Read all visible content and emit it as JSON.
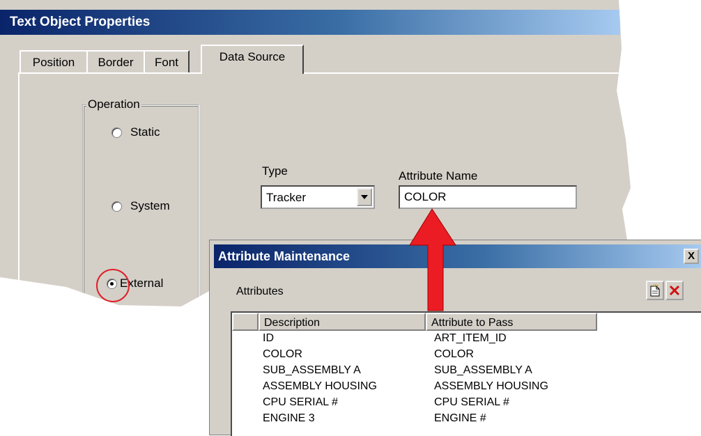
{
  "dialog1": {
    "title": "Text Object Properties",
    "tabs": [
      {
        "label": "Position",
        "active": false
      },
      {
        "label": "Border",
        "active": false
      },
      {
        "label": "Font",
        "active": false
      },
      {
        "label": "Data Source",
        "active": true
      }
    ],
    "operation": {
      "legend": "Operation",
      "options": [
        {
          "label": "Static",
          "selected": false
        },
        {
          "label": "System",
          "selected": false
        },
        {
          "label": "External",
          "selected": true
        }
      ]
    },
    "type": {
      "label": "Type",
      "value": "Tracker"
    },
    "attribute_name": {
      "label": "Attribute Name",
      "value": "COLOR"
    }
  },
  "dialog2": {
    "title": "Attribute Maintenance",
    "close_label": "X",
    "section_label": "Attributes",
    "toolbar": [
      {
        "icon": "new-document-icon"
      },
      {
        "icon": "delete-x-icon"
      }
    ],
    "columns": [
      "Description",
      "Attribute to Pass"
    ],
    "rows": [
      {
        "description": "ID",
        "attribute": "ART_ITEM_ID"
      },
      {
        "description": "COLOR",
        "attribute": "COLOR"
      },
      {
        "description": "SUB_ASSEMBLY A",
        "attribute": "SUB_ASSEMBLY A"
      },
      {
        "description": "ASSEMBLY HOUSING",
        "attribute": "ASSEMBLY HOUSING"
      },
      {
        "description": "CPU SERIAL #",
        "attribute": "CPU SERIAL #"
      },
      {
        "description": "ENGINE 3",
        "attribute": "ENGINE #"
      }
    ]
  },
  "colors": {
    "accent_red": "#e0202a",
    "titlebar_dark": "#0a246a",
    "face": "#d4d0c8"
  }
}
